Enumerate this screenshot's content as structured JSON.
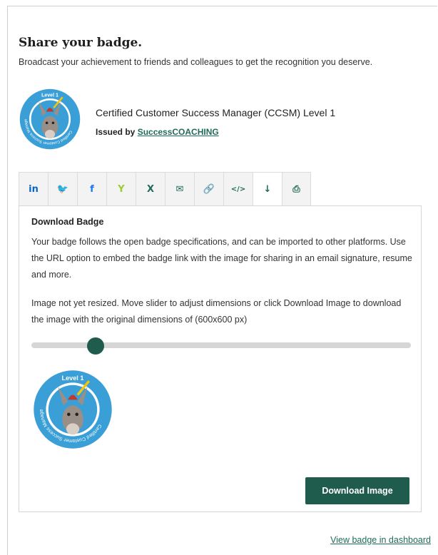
{
  "header": {
    "title": "Share your badge.",
    "subtitle": "Broadcast your achievement to friends and colleagues to get the recognition you deserve."
  },
  "badge": {
    "name": "Certified Customer Success Manager (CCSM) Level 1",
    "issued_by_prefix": "Issued by ",
    "issuer": "SuccessCOACHING",
    "image_level_text": "Level 1",
    "image_ring_text": "Certified Customer Success Manager"
  },
  "share_tabs": [
    {
      "name": "linkedin",
      "glyph": "in",
      "color": "#0a66c2"
    },
    {
      "name": "twitter",
      "glyph": "🐦",
      "color": "#1da1f2"
    },
    {
      "name": "facebook",
      "glyph": "f",
      "color": "#1877f2"
    },
    {
      "name": "yammer",
      "glyph": "Y",
      "color": "#9acd32"
    },
    {
      "name": "xing",
      "glyph": "X",
      "color": "#1f6b5a"
    },
    {
      "name": "email",
      "glyph": "✉",
      "color": "#1f6b5a"
    },
    {
      "name": "link",
      "glyph": "🔗",
      "color": "#1f6b5a"
    },
    {
      "name": "embed",
      "glyph": "</>",
      "color": "#1f6b5a"
    },
    {
      "name": "download",
      "glyph": "↓",
      "color": "#1f6b5a"
    },
    {
      "name": "print",
      "glyph": "⎙",
      "color": "#1f6b5a"
    }
  ],
  "active_tab": "download",
  "download_panel": {
    "title": "Download Badge",
    "description": "Your badge follows the open badge specifications, and can be imported to other platforms. Use the URL option to embed the badge link with the image for sharing in an email signature, resume and more.",
    "note": "Image not yet resized. Move slider to adjust dimensions or click Download Image to download the image with the original dimensions of (600x600 px)",
    "slider_value": 0.17,
    "button_label": "Download Image"
  },
  "footer": {
    "dashboard_link": "View badge in dashboard"
  },
  "colors": {
    "accent": "#1f5c4d",
    "link": "#1f6b5a",
    "badge_blue": "#3a9fd6"
  }
}
